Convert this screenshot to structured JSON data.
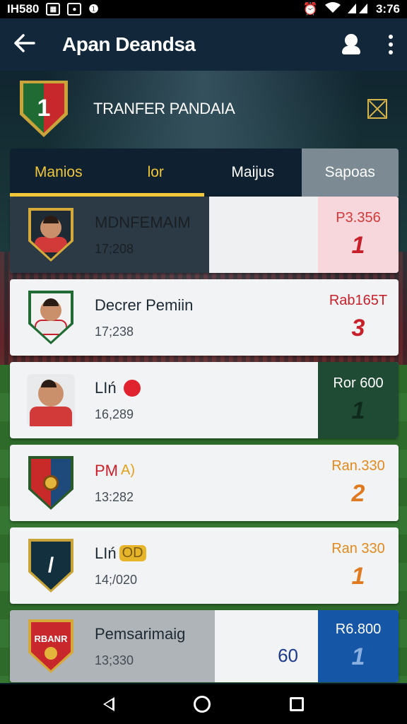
{
  "status_bar": {
    "left_text": "IH580",
    "time": "3:76"
  },
  "app_bar": {
    "title": "Apan Deandsa"
  },
  "header": {
    "crest_letter": "1",
    "title": "TRANFER PANDAIA"
  },
  "tabs": [
    {
      "label": "Manios"
    },
    {
      "label": "lor"
    },
    {
      "label": "Maijus"
    },
    {
      "label": "Sapoas"
    }
  ],
  "rows": [
    {
      "name": "MDNFEMAIM",
      "tag": "",
      "number": "17;208",
      "price": "P3.356",
      "rank": "1"
    },
    {
      "name": "Decrer Pemiin",
      "tag": "",
      "number": "17;238",
      "price": "Rab165T",
      "rank": "3"
    },
    {
      "name": "LIń",
      "tag": "",
      "number": "16,289",
      "price": "Ror 600",
      "rank": "1"
    },
    {
      "name": "PM",
      "tag": "A)",
      "number": "13:282",
      "price": "Ran.330",
      "rank": "2"
    },
    {
      "name": "LIń",
      "tag": "OD",
      "number": "14;/020",
      "price": "Ran 330",
      "rank": "1"
    },
    {
      "name": "Pemsarimaig",
      "tag": "",
      "number": "13;330",
      "price": "R6.800",
      "rank": "1",
      "extra": "60"
    }
  ],
  "colors": {
    "gold": "#f0c73a",
    "red": "#d23a3a",
    "green_panel": "#1f4a34",
    "blue_panel": "#1656a6",
    "pink_panel": "#f7d6dc"
  }
}
